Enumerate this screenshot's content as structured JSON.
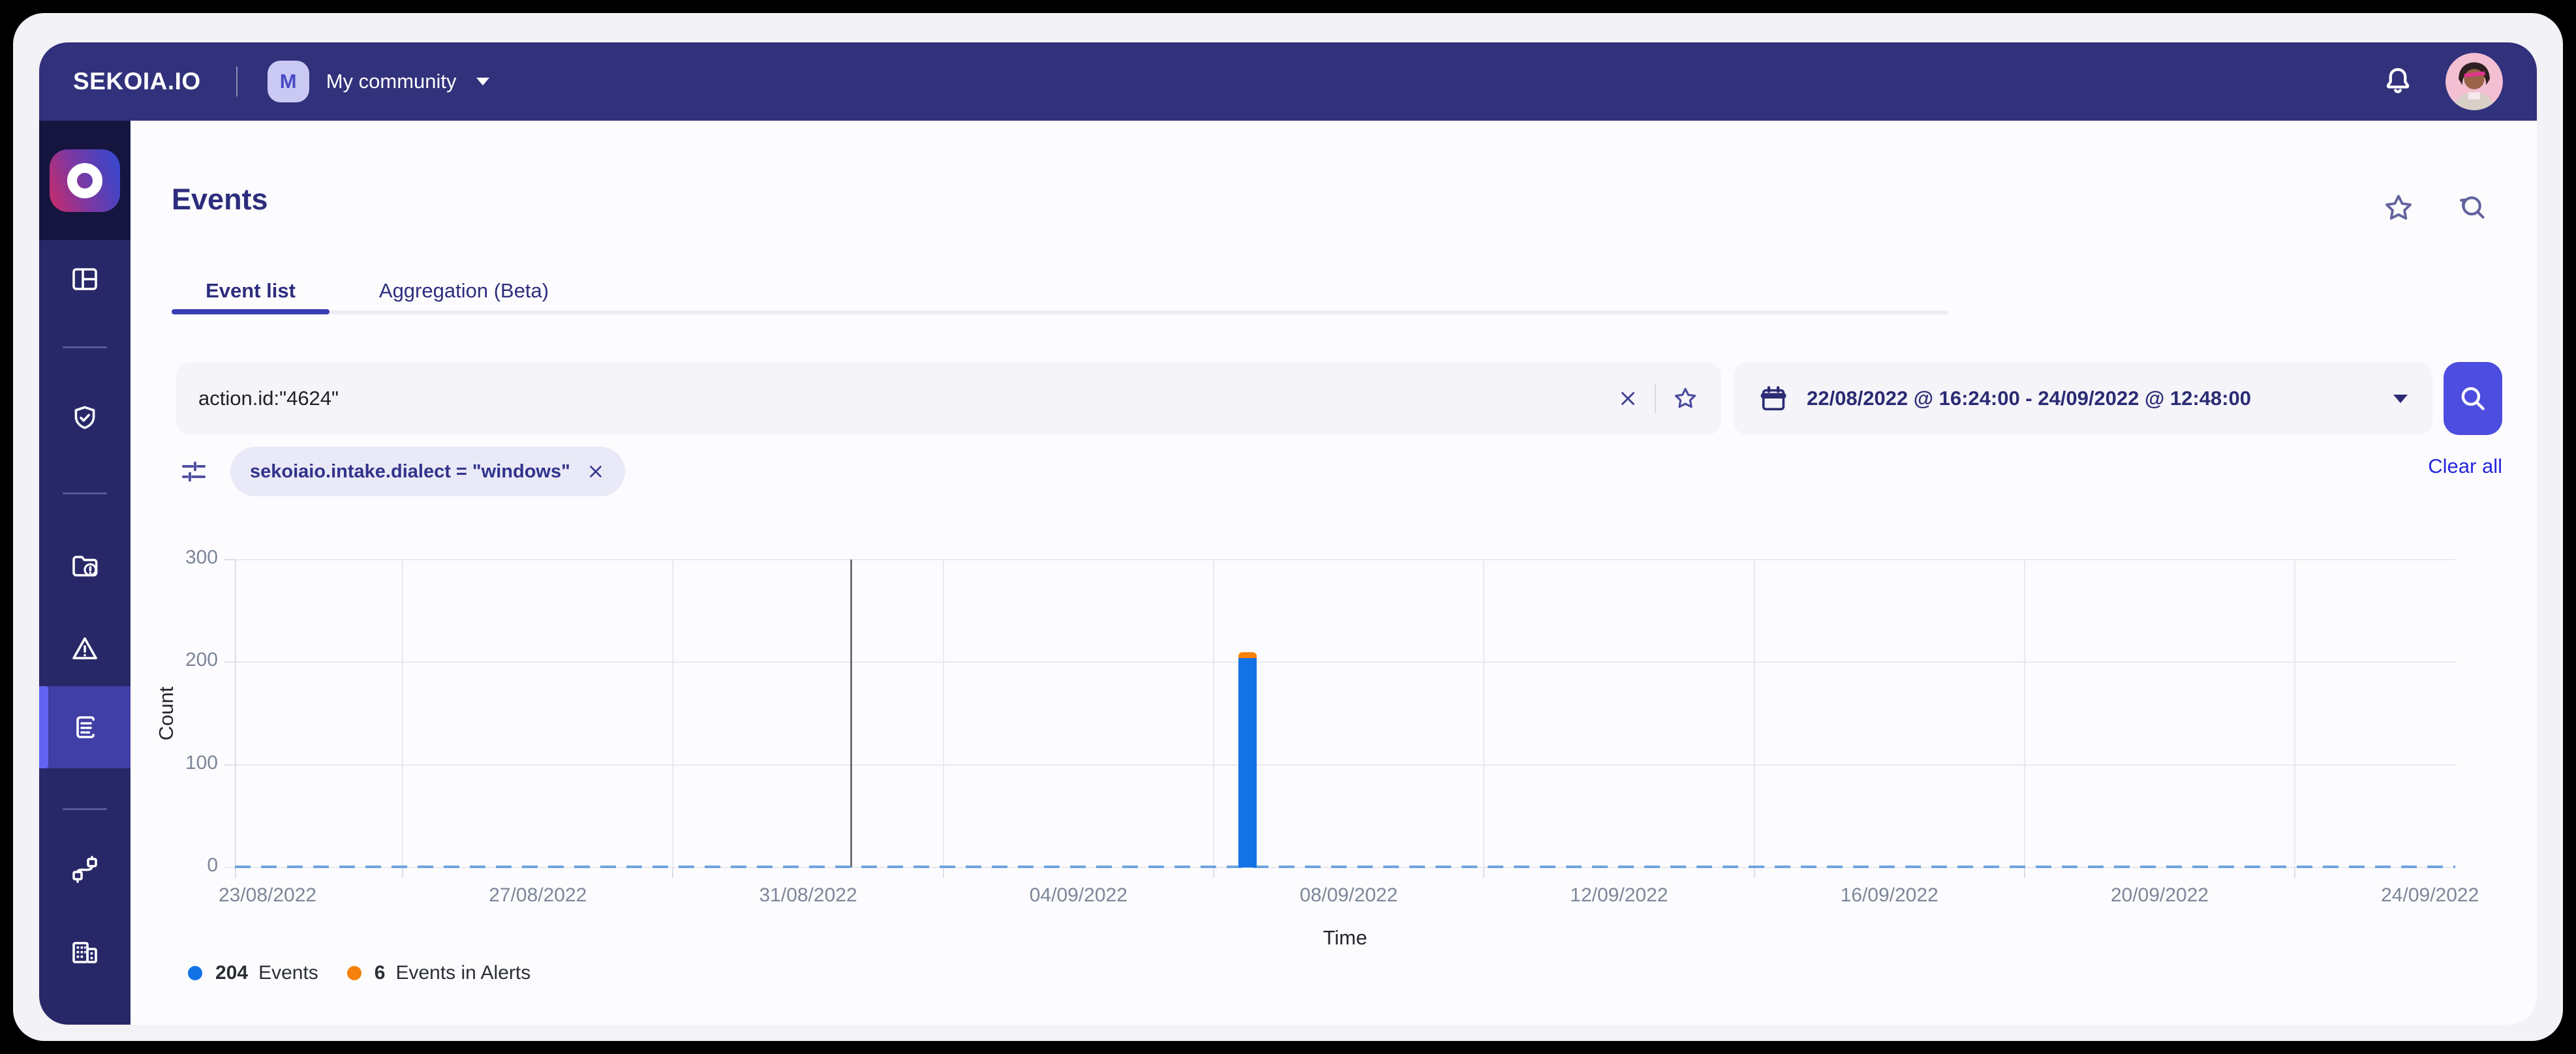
{
  "topbar": {
    "brand": "SEKOIA.IO",
    "community": {
      "initial": "M",
      "name": "My community"
    },
    "icons": [
      "bell-icon",
      "user-avatar"
    ]
  },
  "sidebar": {
    "icons": [
      "app-logo",
      "dashboard-icon",
      "shield-check-icon",
      "folder-alert-icon",
      "warning-triangle-icon",
      "event-list-icon",
      "plug-icon",
      "building-icon"
    ],
    "active_item": "event-list"
  },
  "page": {
    "title": "Events",
    "tabs": [
      {
        "label": "Event list",
        "active": true
      },
      {
        "label": "Aggregation (Beta)",
        "active": false
      }
    ],
    "header_icons": [
      "star-icon",
      "search-history-icon"
    ]
  },
  "search": {
    "query": "action.id:\"4624\"",
    "date_range": "22/08/2022 @ 16:24:00 - 24/09/2022 @ 12:48:00",
    "icons": [
      "clear-x-icon",
      "save-star-icon",
      "calendar-icon",
      "caret-down-icon",
      "magnifier-icon"
    ]
  },
  "filters": {
    "chip": "sekoiaio.intake.dialect = \"windows\"",
    "clear_all": "Clear all"
  },
  "chart_data": {
    "type": "bar",
    "title": "",
    "xlabel": "Time",
    "ylabel": "Count",
    "ylim": [
      0,
      300
    ],
    "y_ticks": [
      0,
      100,
      200,
      300
    ],
    "x_tick_labels": [
      "23/08/2022",
      "27/08/2022",
      "31/08/2022",
      "04/09/2022",
      "08/09/2022",
      "12/09/2022",
      "16/09/2022",
      "20/09/2022",
      "24/09/2022"
    ],
    "x_range": [
      "22/08/2022 16:24:00",
      "24/09/2022 12:48:00"
    ],
    "grid": true,
    "zero_line": "dashed-blue",
    "legend_position": "bottom-left",
    "series": [
      {
        "name": "Events",
        "color": "#1273E6",
        "points": [
          {
            "x": "06/09/2022",
            "y": 204
          }
        ]
      },
      {
        "name": "Events in Alerts",
        "color": "#F6810C",
        "points": [
          {
            "x": "06/09/2022",
            "y": 6
          }
        ]
      }
    ],
    "bar": {
      "date": "06/09/2022",
      "x_frac": 0.456,
      "events": 204,
      "events_in_alerts": 6
    },
    "cursor_x_frac": 0.277,
    "first_tick_frac": 0.0147,
    "last_tick_frac": 0.9886,
    "legend": [
      {
        "count": "204",
        "label": "Events",
        "color": "#1273E6"
      },
      {
        "count": "6",
        "label": "Events in Alerts",
        "color": "#F6810C"
      }
    ]
  },
  "colors": {
    "header_bg": "#31317C",
    "sidebar_bg": "#282869",
    "active_item_bg": "#3F3FA5",
    "accent": "#6363F2",
    "primary_button": "#4D4DE0",
    "link": "#2626DE",
    "bar_blue": "#1273E6",
    "bar_orange": "#F6810C",
    "dashed_zero": "#70A4DE"
  }
}
